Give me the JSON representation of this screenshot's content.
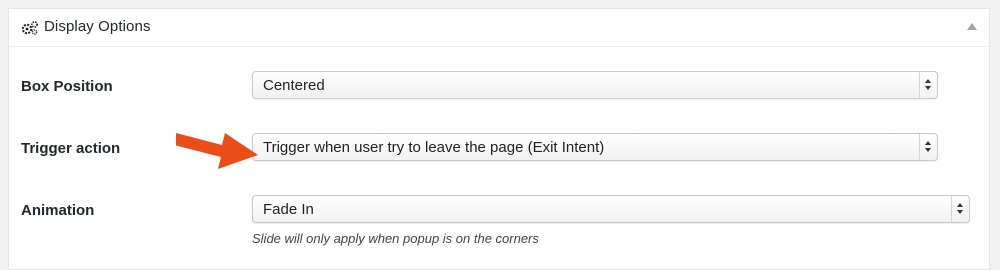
{
  "panel": {
    "title": "Display Options",
    "title_icon": "gear-icon",
    "toggle_icon": "triangle-up-icon"
  },
  "fields": [
    {
      "label": "Box Position",
      "value": "Centered"
    },
    {
      "label": "Trigger action",
      "value": "Trigger when user try to leave the page (Exit Intent)"
    },
    {
      "label": "Animation",
      "value": "Fade In",
      "hint": "Slide will only apply when popup is on the corners"
    }
  ],
  "annotation": {
    "icon": "arrow-right-icon",
    "color": "#ea4d17"
  }
}
